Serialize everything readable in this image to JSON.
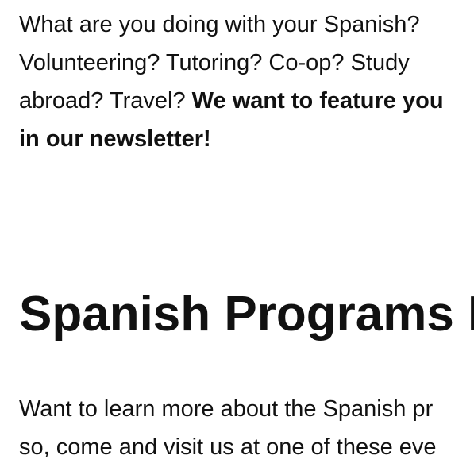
{
  "intro": {
    "text": "What are you doing with your Spanish? Volunteering? Tutoring? Co-op? Study abroad? Travel? ",
    "emphasis": "We want to feature you in our newsletter!"
  },
  "section": {
    "heading": "Spanish Programs I",
    "line1": "Want to learn more about the Spanish pr",
    "line2": "so, come and visit us at one of these eve"
  }
}
